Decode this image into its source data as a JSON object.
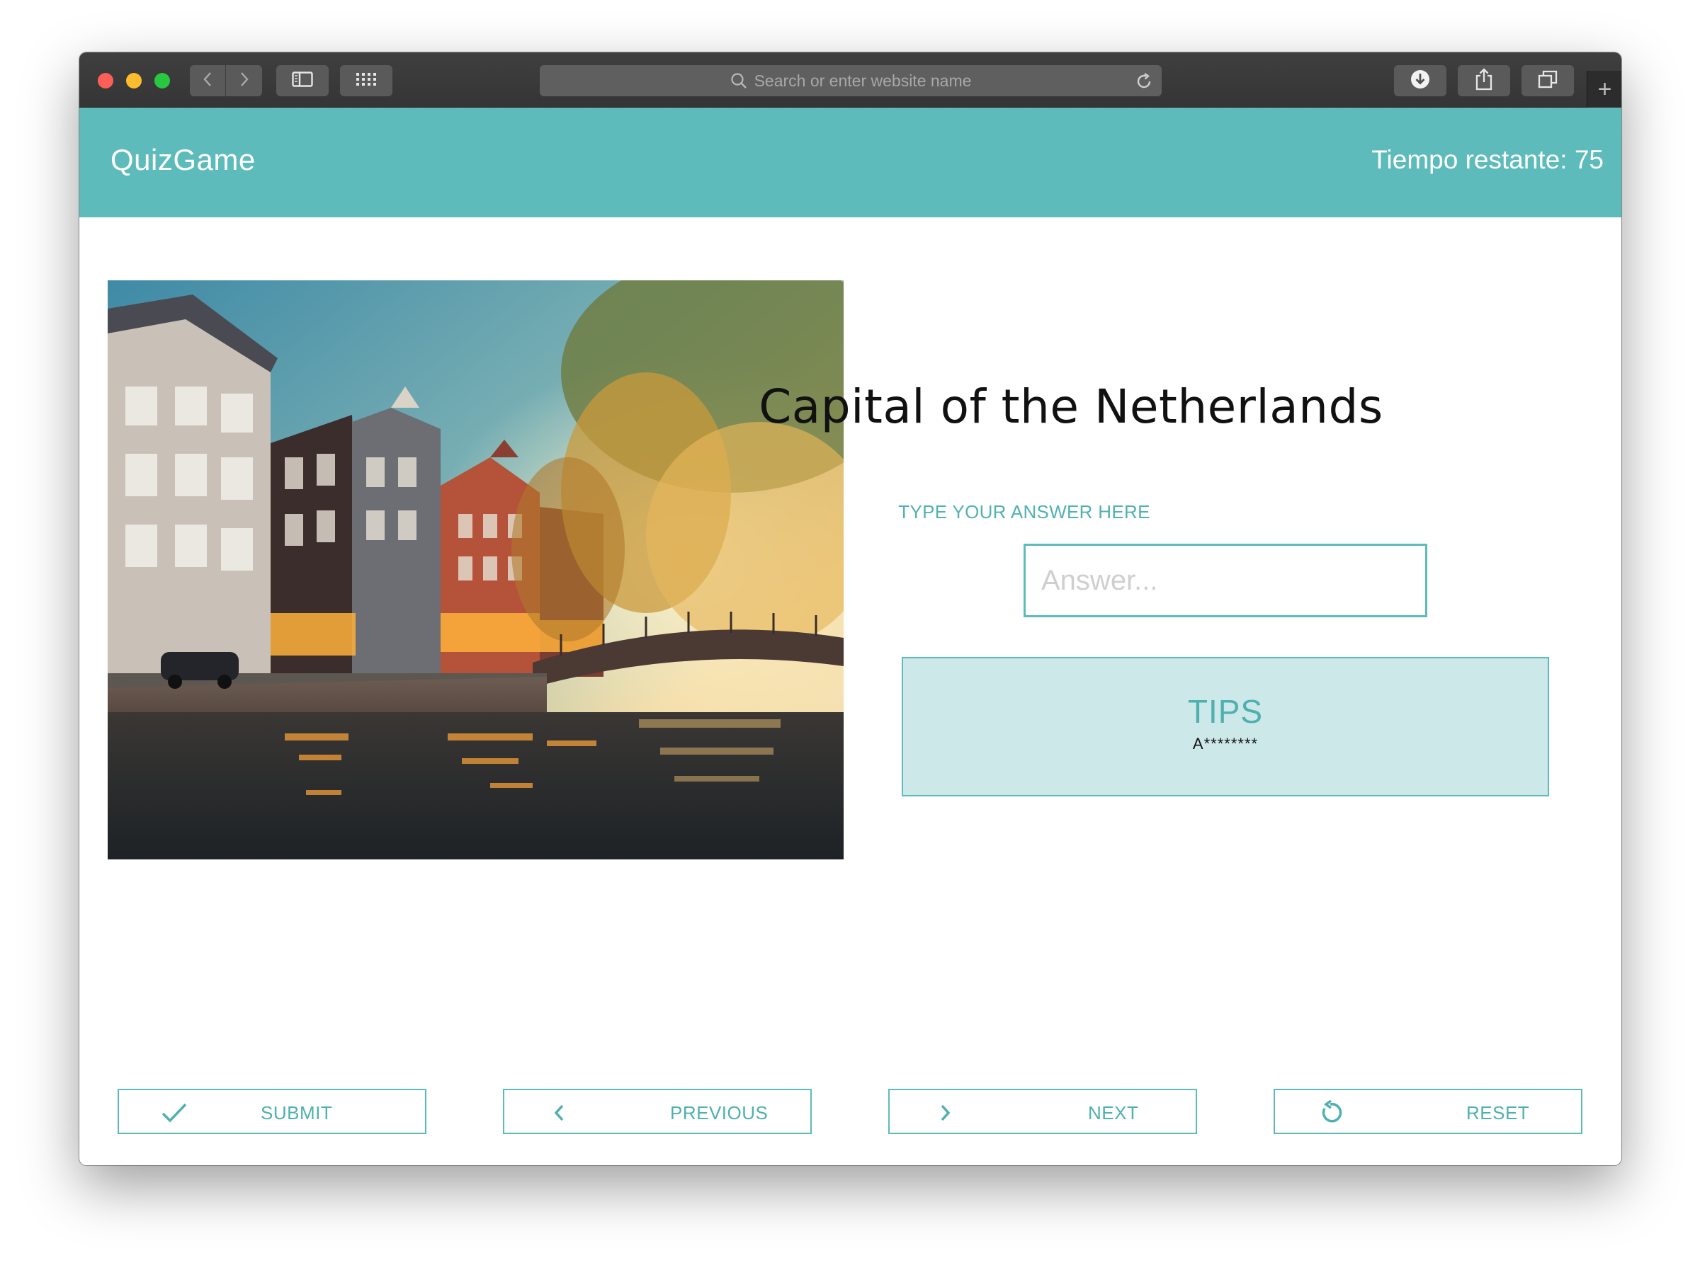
{
  "browser": {
    "address_placeholder": "Search or enter website name",
    "new_tab_label": "+"
  },
  "header": {
    "title": "QuizGame",
    "timer": "Tiempo restante: 75"
  },
  "question": {
    "text": "Capital of the Netherlands",
    "answer_label": "TYPE YOUR ANSWER HERE",
    "answer_placeholder": "Answer...",
    "answer_value": ""
  },
  "tips": {
    "title": "TIPS",
    "hint": "A********"
  },
  "actions": {
    "submit": "SUBMIT",
    "previous": "PREVIOUS",
    "next": "NEXT",
    "reset": "RESET"
  },
  "colors": {
    "accent": "#5dbbbb",
    "tips_background": "#cde8e8",
    "toolbar": "#3a3a3a"
  },
  "icons": {
    "submit": "check-icon",
    "previous": "chevron-left-icon",
    "next": "chevron-right-icon",
    "reset": "reset-icon"
  }
}
